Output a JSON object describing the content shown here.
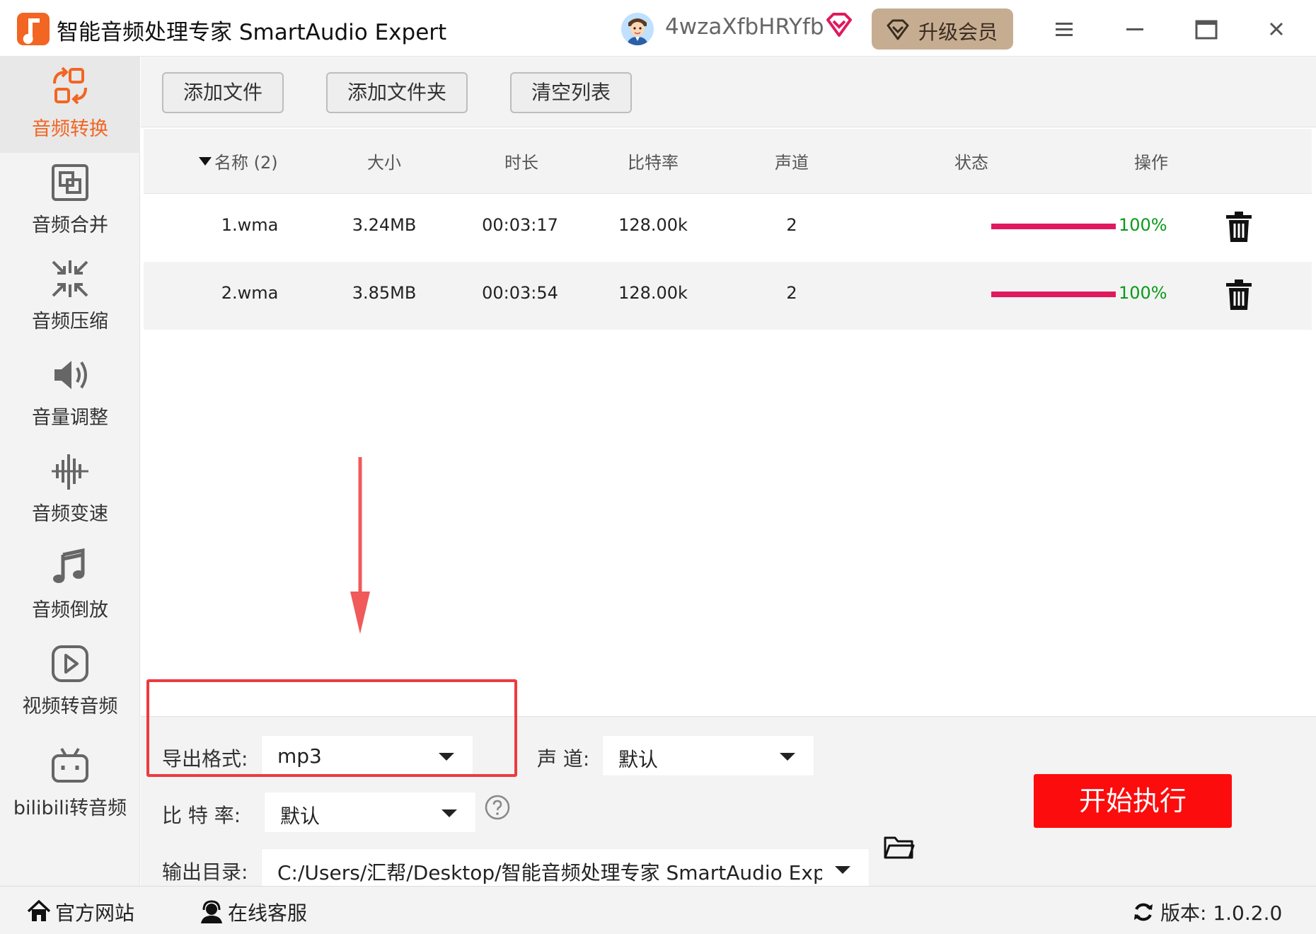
{
  "app": {
    "title": "智能音频处理专家 SmartAudio Expert",
    "username": "4wzaXfbHRYfb",
    "upgrade_label": "升级会员"
  },
  "colors": {
    "accent": "#f26522",
    "progress": "#e0195f",
    "progress_text": "#0a9a1a",
    "start_button": "#fc0c0c",
    "highlight": "#ec3b40",
    "upgrade_bg": "#c6ad92",
    "vip_badge": "#e0195f"
  },
  "sidebar": {
    "items": [
      {
        "label": "音频转换",
        "icon": "audio-convert-icon",
        "active": true
      },
      {
        "label": "音频合并",
        "icon": "audio-merge-icon",
        "active": false
      },
      {
        "label": "音频压缩",
        "icon": "audio-compress-icon",
        "active": false
      },
      {
        "label": "音量调整",
        "icon": "volume-icon",
        "active": false
      },
      {
        "label": "音频变速",
        "icon": "speed-icon",
        "active": false
      },
      {
        "label": "音频倒放",
        "icon": "music-note-icon",
        "active": false
      },
      {
        "label": "视频转音频",
        "icon": "video-play-icon",
        "active": false
      },
      {
        "label": "bilibili转音频",
        "icon": "bilibili-tv-icon",
        "active": false
      }
    ]
  },
  "toolbar": {
    "add_file": "添加文件",
    "add_folder": "添加文件夹",
    "clear_list": "清空列表"
  },
  "table": {
    "columns": {
      "name": "名称 (2)",
      "size": "大小",
      "duration": "时长",
      "bitrate": "比特率",
      "channels": "声道",
      "status": "状态",
      "action": "操作"
    },
    "rows": [
      {
        "name": "1.wma",
        "size": "3.24MB",
        "duration": "00:03:17",
        "bitrate": "128.00k",
        "channels": "2",
        "progress": 100,
        "progress_label": "100%"
      },
      {
        "name": "2.wma",
        "size": "3.85MB",
        "duration": "00:03:54",
        "bitrate": "128.00k",
        "channels": "2",
        "progress": 100,
        "progress_label": "100%"
      }
    ]
  },
  "settings": {
    "format_label": "导出格式:",
    "format_value": "mp3",
    "channel_label": "声 道:",
    "channel_value": "默认",
    "bitrate_label": "比 特 率:",
    "bitrate_value": "默认",
    "output_label": "输出目录:",
    "output_value": "C:/Users/汇帮/Desktop/智能音频处理专家 SmartAudio Exp",
    "start_label": "开始执行"
  },
  "statusbar": {
    "website": "官方网站",
    "support": "在线客服",
    "version": "版本: 1.0.2.0"
  }
}
